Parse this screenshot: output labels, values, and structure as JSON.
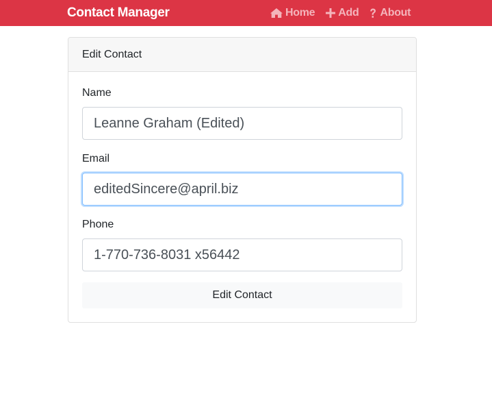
{
  "navbar": {
    "brand": "Contact Manager",
    "links": [
      {
        "label": "Home",
        "icon": "home-icon"
      },
      {
        "label": "Add",
        "icon": "plus-icon"
      },
      {
        "label": "About",
        "icon": "question-icon"
      }
    ],
    "bg_color": "#dc3545"
  },
  "card": {
    "header": "Edit Contact",
    "fields": [
      {
        "label": "Name",
        "value": "Leanne Graham (Edited)"
      },
      {
        "label": "Email",
        "value": "editedSincere@april.biz",
        "focused": true
      },
      {
        "label": "Phone",
        "value": "1-770-736-8031 x56442"
      }
    ],
    "submit_label": "Edit Contact"
  }
}
